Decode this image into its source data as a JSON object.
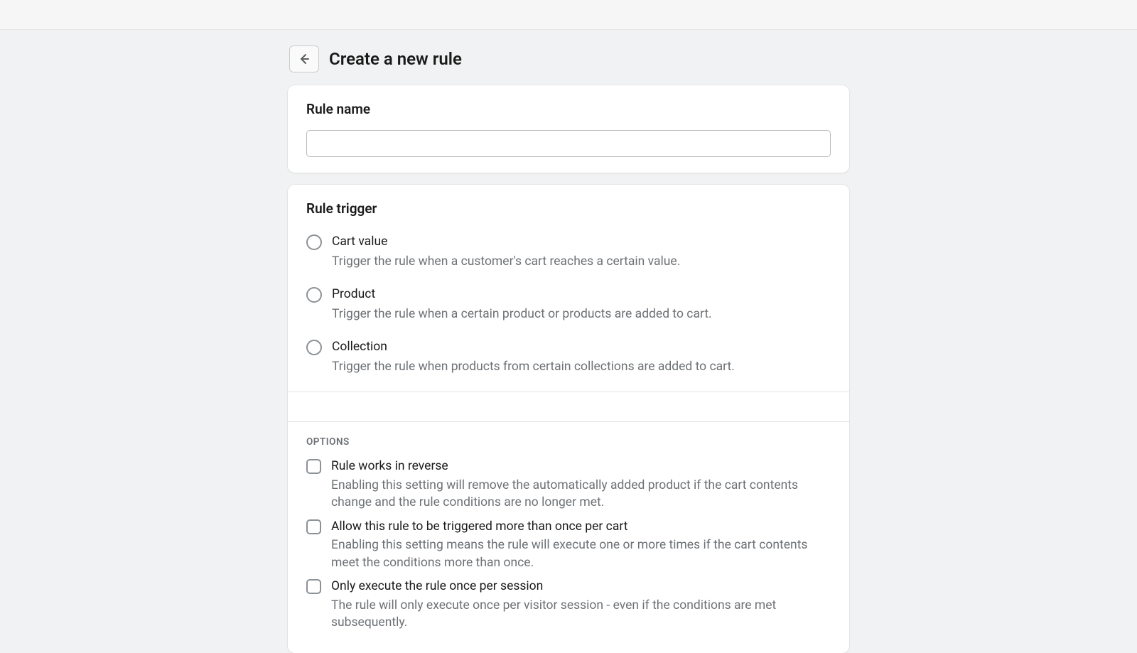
{
  "header": {
    "title": "Create a new rule"
  },
  "ruleName": {
    "label": "Rule name",
    "value": ""
  },
  "ruleTrigger": {
    "label": "Rule trigger",
    "options": [
      {
        "label": "Cart value",
        "description": "Trigger the rule when a customer's cart reaches a certain value."
      },
      {
        "label": "Product",
        "description": "Trigger the rule when a certain product or products are added to cart."
      },
      {
        "label": "Collection",
        "description": "Trigger the rule when products from certain collections are added to cart."
      }
    ]
  },
  "optionsSection": {
    "heading": "OPTIONS",
    "items": [
      {
        "label": "Rule works in reverse",
        "description": "Enabling this setting will remove the automatically added product if the cart contents change and the rule conditions are no longer met."
      },
      {
        "label": "Allow this rule to be triggered more than once per cart",
        "description": "Enabling this setting means the rule will execute one or more times if the cart contents meet the conditions more than once."
      },
      {
        "label": "Only execute the rule once per session",
        "description": "The rule will only execute once per visitor session - even if the conditions are met subsequently."
      }
    ]
  }
}
